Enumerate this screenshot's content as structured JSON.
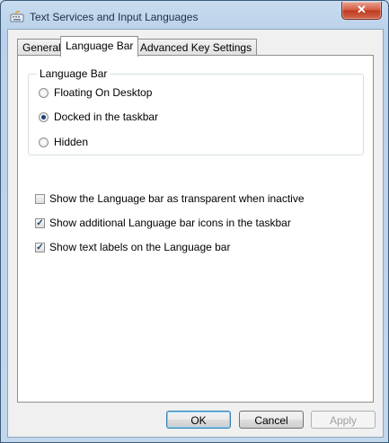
{
  "window": {
    "title": "Text Services and Input Languages",
    "close_glyph": "✕"
  },
  "tabs": [
    {
      "label": "General"
    },
    {
      "label": "Language Bar",
      "active": true
    },
    {
      "label": "Advanced Key Settings"
    }
  ],
  "group": {
    "label": "Language Bar",
    "options": [
      {
        "label": "Floating On Desktop",
        "selected": false
      },
      {
        "label": "Docked in the taskbar",
        "selected": true
      },
      {
        "label": "Hidden",
        "selected": false
      }
    ]
  },
  "checkboxes": [
    {
      "label": "Show the Language bar as transparent when inactive",
      "checked": false
    },
    {
      "label": "Show additional Language bar icons in the taskbar",
      "checked": true
    },
    {
      "label": "Show text labels on the Language bar",
      "checked": true
    }
  ],
  "buttons": {
    "ok": "OK",
    "cancel": "Cancel",
    "apply": "Apply"
  },
  "check_glyph": "✓"
}
